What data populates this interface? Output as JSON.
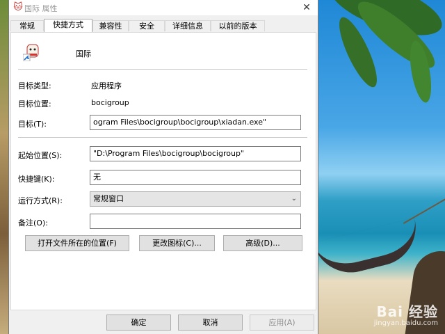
{
  "window": {
    "title": "国际 属性",
    "close_glyph": "✕"
  },
  "tabs": [
    {
      "label": "常规"
    },
    {
      "label": "快捷方式"
    },
    {
      "label": "兼容性"
    },
    {
      "label": "安全"
    },
    {
      "label": "详细信息"
    },
    {
      "label": "以前的版本"
    }
  ],
  "shortcut": {
    "name": "国际",
    "target_type_label": "目标类型:",
    "target_type": "应用程序",
    "target_location_label": "目标位置:",
    "target_location": "bocigroup",
    "target_label": "目标(T):",
    "target": "ogram Files\\bocigroup\\bocigroup\\xiadan.exe\"",
    "start_in_label": "起始位置(S):",
    "start_in": "\"D:\\Program Files\\bocigroup\\bocigroup\"",
    "shortcut_key_label": "快捷键(K):",
    "shortcut_key": "无",
    "run_label": "运行方式(R):",
    "run": "常规窗口",
    "comment_label": "备注(O):",
    "comment": "",
    "open_location_button": "打开文件所在的位置(F)",
    "change_icon_button": "更改图标(C)...",
    "advanced_button": "高级(D)..."
  },
  "footer": {
    "ok": "确定",
    "cancel": "取消",
    "apply": "应用(A)"
  },
  "watermark": {
    "main": "Bai 经验",
    "sub": "jingyan.baidu.com"
  },
  "colors": {
    "title_icon": "#c9302c",
    "dialog_bg": "#f0f0f0",
    "panel_bg": "#ffffff"
  }
}
